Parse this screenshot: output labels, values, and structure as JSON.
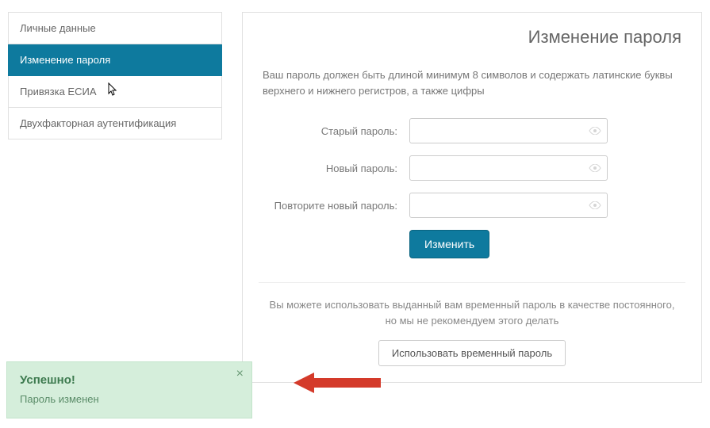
{
  "sidebar": {
    "items": [
      {
        "label": "Личные данные"
      },
      {
        "label": "Изменение пароля"
      },
      {
        "label": "Привязка ЕСИА"
      },
      {
        "label": "Двухфакторная аутентификация"
      }
    ]
  },
  "panel": {
    "title": "Изменение пароля",
    "hint": "Ваш пароль должен быть длиной минимум 8 символов и содержать латинские буквы верхнего и нижнего регистров, а также цифры",
    "labels": {
      "old": "Старый пароль:",
      "new": "Новый пароль:",
      "repeat": "Повторите новый пароль:"
    },
    "submit": "Изменить",
    "secondary_hint": "Вы можете использовать выданный вам временный пароль в качестве постоянного, но мы не рекомендуем этого делать",
    "use_temp": "Использовать временный пароль"
  },
  "toast": {
    "title": "Успешно!",
    "message": "Пароль изменен",
    "close": "×"
  }
}
